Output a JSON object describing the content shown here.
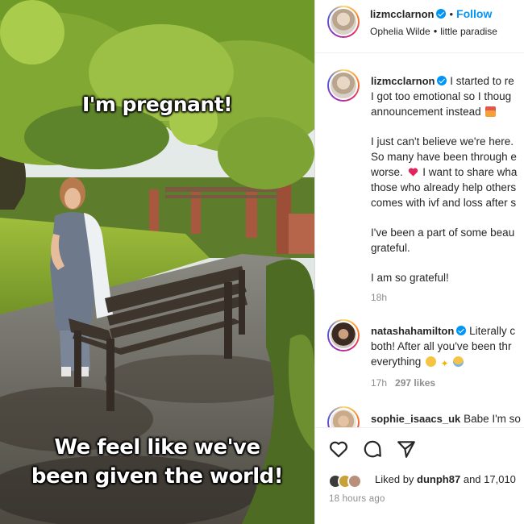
{
  "photo": {
    "caption_top": "I'm pregnant!",
    "caption_bottom_line1": "We feel like we've",
    "caption_bottom_line2": "been given the world!"
  },
  "header": {
    "username": "lizmcclarnon",
    "follow_label": "Follow",
    "music_artist": "Ophelia Wilde",
    "music_track": "little paradise",
    "separator": "•"
  },
  "post": {
    "username": "lizmcclarnon",
    "lines": [
      "I started to re",
      "I got too emotional so I thoug",
      "announcement instead",
      "I just can't believe we're here.",
      "So many have been through e",
      "worse.",
      "I want to share wha",
      "those who already help others",
      "comes with ivf and loss after s",
      "I've been a part of some beau",
      "grateful.",
      "I am so grateful!"
    ],
    "time": "18h"
  },
  "comments": [
    {
      "username": "natashahamilton",
      "text_first": "Literally c",
      "line2": "both! After all you've been thr",
      "line3": "everything",
      "time": "17h",
      "likes": "297 likes"
    },
    {
      "username": "sophie_isaacs_uk",
      "text_first": "Babe I'm so"
    }
  ],
  "actions": {
    "icons": [
      "heart-icon",
      "comment-icon",
      "share-icon"
    ],
    "liked_prefix": "Liked by",
    "liked_user": "dunph87",
    "liked_suffix": "and 17,010",
    "posted_ago": "18 hours ago"
  },
  "colors": {
    "link_blue": "#0095f6",
    "verified_blue": "#0095f6",
    "heart_red": "#e0245e"
  }
}
